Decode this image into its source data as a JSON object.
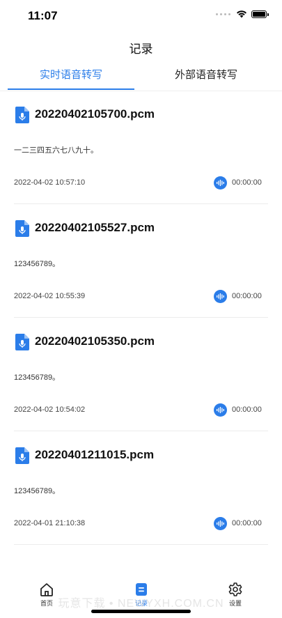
{
  "status_bar": {
    "time": "11:07"
  },
  "header": {
    "title": "记录"
  },
  "tabs": [
    {
      "label": "实时语音转写",
      "active": true
    },
    {
      "label": "外部语音转写",
      "active": false
    }
  ],
  "records": [
    {
      "file_name": "20220402105700.pcm",
      "content": "一二三四五六七八九十。",
      "date": "2022-04-02 10:57:10",
      "duration": "00:00:00"
    },
    {
      "file_name": "20220402105527.pcm",
      "content": "123456789。",
      "date": "2022-04-02 10:55:39",
      "duration": "00:00:00"
    },
    {
      "file_name": "20220402105350.pcm",
      "content": "123456789。",
      "date": "2022-04-02 10:54:02",
      "duration": "00:00:00"
    },
    {
      "file_name": "20220401211015.pcm",
      "content": "123456789。",
      "date": "2022-04-01 21:10:38",
      "duration": "00:00:00"
    }
  ],
  "tabbar": [
    {
      "label": "首页",
      "icon": "home-icon",
      "active": false
    },
    {
      "label": "记录",
      "icon": "records-icon",
      "active": true
    },
    {
      "label": "设置",
      "icon": "gear-icon",
      "active": false
    }
  ],
  "watermark": "玩意下载 • NEWYXH.COM.CN",
  "colors": {
    "accent": "#2b7de9",
    "divider": "#ececec"
  }
}
